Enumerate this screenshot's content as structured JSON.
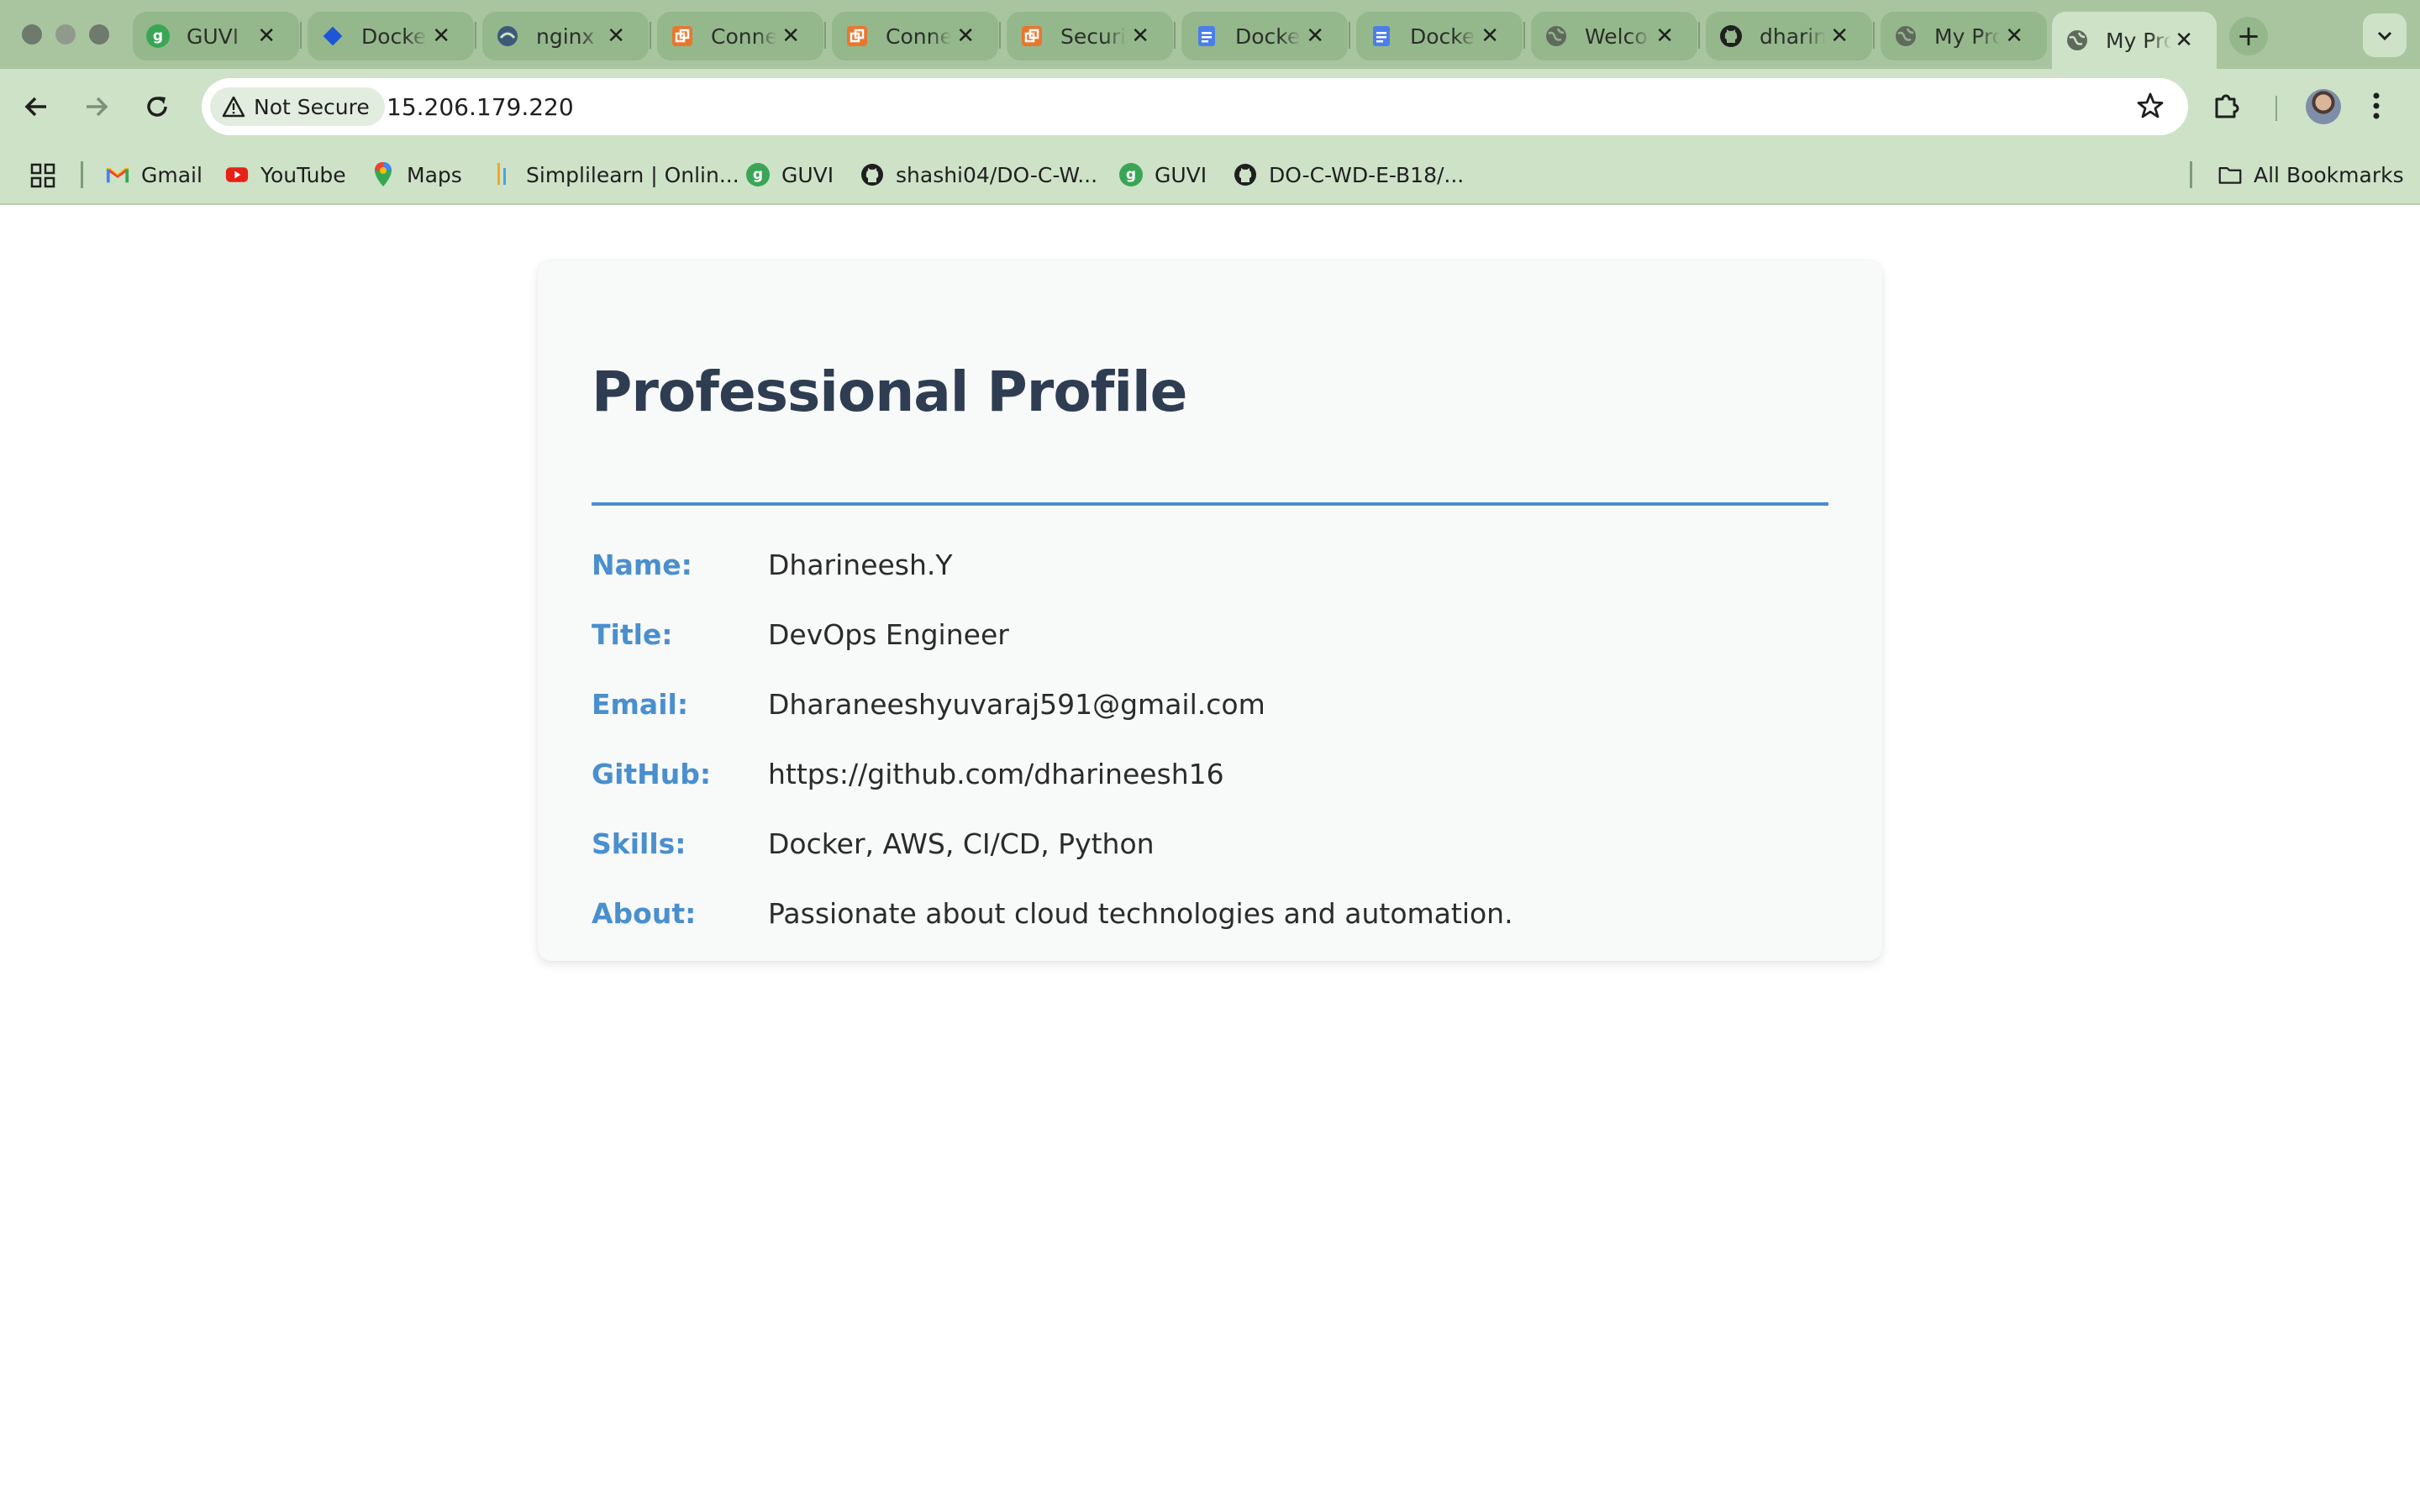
{
  "tabs": [
    {
      "title": "GUVI",
      "icon": "guvi-icon",
      "color": "#3aa655"
    },
    {
      "title": "Docker",
      "icon": "jira-diamond-icon",
      "color": "#1e56d8"
    },
    {
      "title": "nginx",
      "icon": "nginx-icon",
      "color": "#3c5a78"
    },
    {
      "title": "Connect",
      "icon": "aws-connect-icon",
      "color": "#e8772e"
    },
    {
      "title": "Connect",
      "icon": "aws-connect-icon",
      "color": "#e8772e"
    },
    {
      "title": "Security",
      "icon": "aws-connect-icon",
      "color": "#e8772e"
    },
    {
      "title": "Docker",
      "icon": "google-docs-icon",
      "color": "#4a7ee8"
    },
    {
      "title": "Docker",
      "icon": "google-docs-icon",
      "color": "#4a7ee8"
    },
    {
      "title": "Welcome",
      "icon": "globe-icon",
      "color": "#5f6a5d"
    },
    {
      "title": "dharineesh",
      "icon": "github-icon",
      "color": "#1e221d"
    },
    {
      "title": "My Profile",
      "icon": "globe-icon",
      "color": "#5f6a5d"
    },
    {
      "title": "My Profile",
      "icon": "globe-icon",
      "color": "#5f6a5d",
      "active": true
    }
  ],
  "toolbar": {
    "security_label": "Not Secure",
    "url": "15.206.179.220"
  },
  "bookmarks": {
    "items": [
      {
        "label": "Gmail",
        "icon": "gmail-icon"
      },
      {
        "label": "YouTube",
        "icon": "youtube-icon"
      },
      {
        "label": "Maps",
        "icon": "maps-icon"
      },
      {
        "label": "Simplilearn | Onlin...",
        "icon": "simplilearn-icon"
      },
      {
        "label": "GUVI",
        "icon": "guvi-icon"
      },
      {
        "label": "shashi04/DO-C-W...",
        "icon": "github-icon"
      },
      {
        "label": "GUVI",
        "icon": "guvi-icon"
      },
      {
        "label": "DO-C-WD-E-B18/...",
        "icon": "github-icon"
      }
    ],
    "all_bookmarks_label": "All Bookmarks"
  },
  "profile": {
    "heading": "Professional Profile",
    "accent_color": "#4a8fce",
    "fields": [
      {
        "key": "Name:",
        "value": "Dharineesh.Y"
      },
      {
        "key": "Title:",
        "value": "DevOps Engineer"
      },
      {
        "key": "Email:",
        "value": "Dharaneeshyuvaraj591@gmail.com"
      },
      {
        "key": "GitHub:",
        "value": "https://github.com/dharineesh16"
      },
      {
        "key": "Skills:",
        "value": "Docker, AWS, CI/CD, Python"
      },
      {
        "key": "About:",
        "value": "Passionate about cloud technologies and automation."
      }
    ]
  }
}
